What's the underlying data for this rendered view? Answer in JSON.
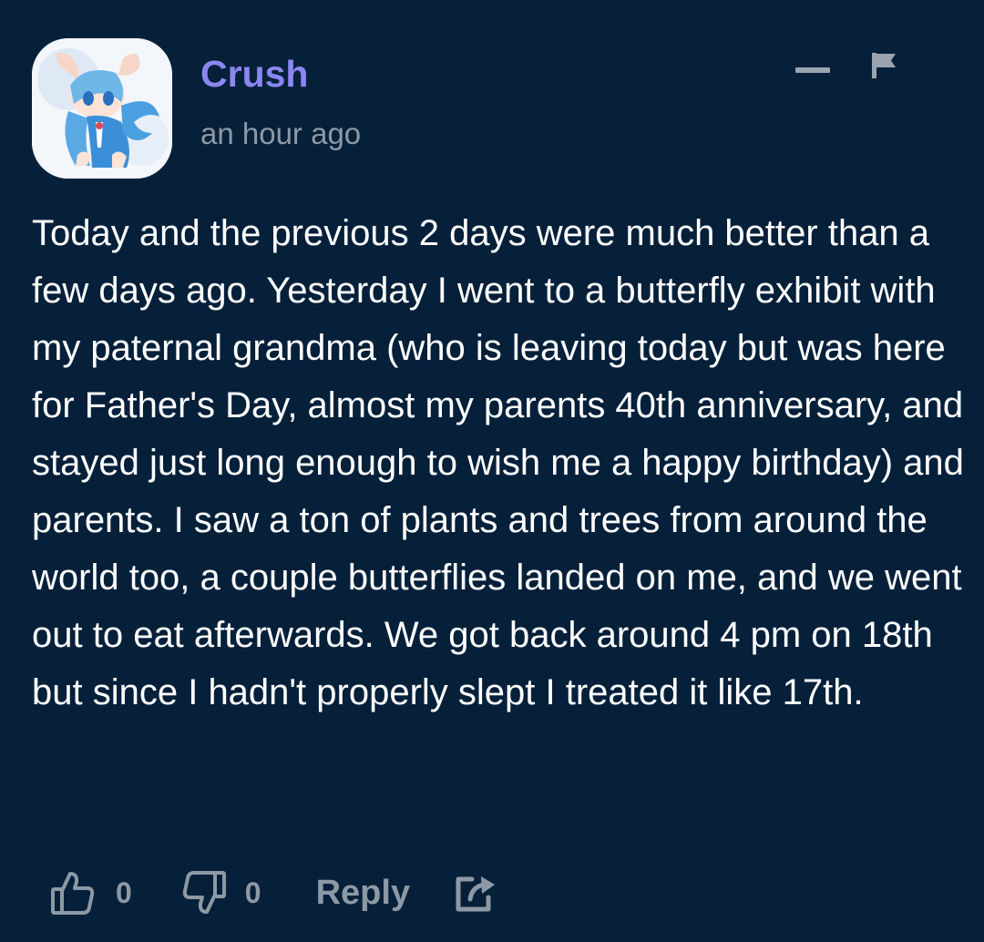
{
  "comment": {
    "author": "Crush",
    "timestamp": "an hour ago",
    "body": "Today and the previous 2 days were much better than a few days ago. Yesterday I went to a butterfly exhibit with my paternal grandma (who is leaving today but was here for Father's Day, almost my parents 40th anniversary, and stayed just long enough to wish me a happy birthday) and parents. I saw a ton of plants and trees from around the world too, a couple butterflies landed on me, and we went out to eat afterwards. We got back around 4 pm on 18th but since I hadn't properly slept I treated it like 17th.",
    "likes": "0",
    "dislikes": "0",
    "reply_label": "Reply"
  },
  "icons": {
    "collapse": "minus-icon",
    "report": "flag-icon",
    "like": "thumbs-up-icon",
    "dislike": "thumbs-down-icon",
    "share": "share-icon"
  },
  "colors": {
    "background": "#06203a",
    "author": "#8b86f2",
    "muted": "#8d99a5",
    "text": "#ffffff"
  }
}
